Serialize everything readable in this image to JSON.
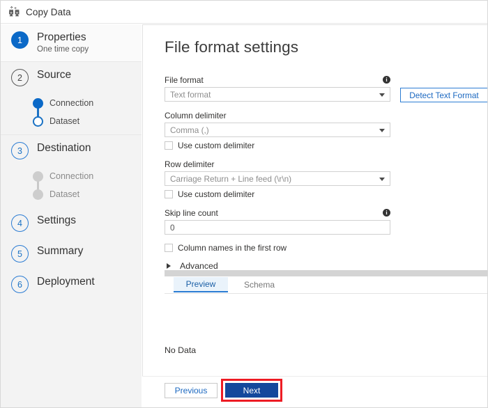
{
  "window": {
    "title": "Copy Data",
    "icon": "copy-data-icon"
  },
  "sidebar": {
    "steps": [
      {
        "number": "1",
        "label": "Properties",
        "sublabel": "One time copy",
        "state": "active",
        "marker": "filled"
      },
      {
        "number": "2",
        "label": "Source",
        "state": "visited",
        "marker": "outline-dark",
        "substeps": [
          {
            "label": "Connection",
            "marker": "blue-filled"
          },
          {
            "label": "Dataset",
            "marker": "blue-open"
          }
        ]
      },
      {
        "number": "3",
        "label": "Destination",
        "state": "upcoming",
        "marker": "outline-blue",
        "substeps": [
          {
            "label": "Connection",
            "marker": "grey-filled"
          },
          {
            "label": "Dataset",
            "marker": "grey-filled"
          }
        ]
      },
      {
        "number": "4",
        "label": "Settings",
        "state": "upcoming",
        "marker": "outline-blue"
      },
      {
        "number": "5",
        "label": "Summary",
        "state": "upcoming",
        "marker": "outline-blue"
      },
      {
        "number": "6",
        "label": "Deployment",
        "state": "upcoming",
        "marker": "outline-blue"
      }
    ]
  },
  "main": {
    "page_title": "File format settings",
    "fields": {
      "file_format": {
        "label": "File format",
        "value": "Text format",
        "info_glyph": "i",
        "detect_button": "Detect Text Format"
      },
      "column_delimiter": {
        "label": "Column delimiter",
        "value": "Comma (,)",
        "checkbox_label": "Use custom delimiter",
        "checked": false
      },
      "row_delimiter": {
        "label": "Row delimiter",
        "value": "Carriage Return + Line feed (\\r\\n)",
        "checkbox_label": "Use custom delimiter",
        "checked": false
      },
      "skip_line_count": {
        "label": "Skip line count",
        "value": "0",
        "info_glyph": "i"
      },
      "first_row_header": {
        "checkbox_label": "Column names in the first row",
        "checked": false
      },
      "advanced": {
        "label": "Advanced",
        "expanded": false
      }
    },
    "preview": {
      "tabs": [
        {
          "label": "Preview",
          "selected": true
        },
        {
          "label": "Schema",
          "selected": false
        }
      ],
      "empty_message": "No Data"
    }
  },
  "footer": {
    "previous_label": "Previous",
    "next_label": "Next",
    "next_highlight_color": "#ed1c24"
  },
  "colors": {
    "accent_blue": "#0b69c7",
    "link_blue": "#1b68c0",
    "primary_button": "#14489c",
    "sidebar_bg": "#f3f3f3",
    "annotation_red": "#ed1c24"
  }
}
